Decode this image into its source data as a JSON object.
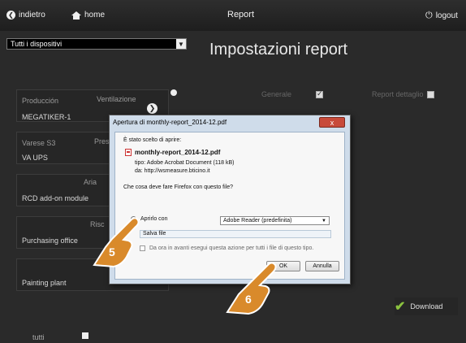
{
  "topbar": {
    "back_label": "indietro",
    "home_label": "home",
    "title": "Report",
    "logout_label": "logout"
  },
  "left": {
    "device_select": "Tutti i dispositivi",
    "tutti_label": "tutti"
  },
  "heading": "Impostazioni report",
  "options": {
    "generale_label": "Generale",
    "report_dettaglio_label": "Report dettaglio"
  },
  "rows": [
    {
      "name": "Producción",
      "col2": "Ventilazione"
    },
    {
      "name": "MEGATIKER-1",
      "col2": ""
    },
    {
      "name": "Varese S3",
      "col2": "Pres"
    },
    {
      "name": "VA UPS",
      "col2": ""
    },
    {
      "name": "",
      "col2": "Aria"
    },
    {
      "name": "RCD add-on module",
      "col2": ""
    },
    {
      "name": "",
      "col2": "Risc"
    },
    {
      "name": "Purchasing office",
      "col2": ""
    },
    {
      "name": "Painting plant",
      "col2": ""
    }
  ],
  "download_label": "Download",
  "dialog": {
    "title": "Apertura di monthly-report_2014-12.pdf",
    "close_label": "x",
    "chosen_label": "È stato scelto di aprire:",
    "filename": "monthly-report_2014-12.pdf",
    "type_line": "tipo: Adobe Acrobat Document (118 kB)",
    "from_line": "da: http://wsmeasure.bticino.it",
    "question": "Che cosa deve fare Firefox con questo file?",
    "open_with_label": "Aprirlo con",
    "open_with_app": "Adobe Reader  (predefinita)",
    "save_label": "Salva file",
    "always_label": "Da ora in avanti esegui questa azione per tutti i file di questo tipo.",
    "ok_label": "OK",
    "cancel_label": "Annulla"
  },
  "steps": {
    "step5": "5",
    "step6": "6"
  },
  "colors": {
    "accent_check": "#8bc23f",
    "close_button": "#c84a3a",
    "dialog_frame": "#cfdcea"
  }
}
